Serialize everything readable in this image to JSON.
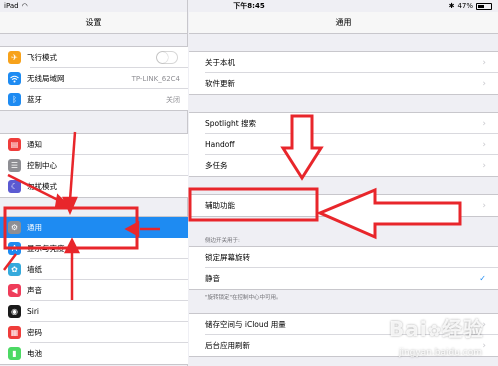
{
  "status_bar": {
    "device": "iPad",
    "time": "下午8:45",
    "battery": "47%",
    "battery_fraction": 0.47
  },
  "left_pane": {
    "title": "设置",
    "group1": [
      {
        "label": "飞行模式",
        "icon": "airplane-icon",
        "color": "#f7a21b",
        "value": "",
        "toggle": false
      },
      {
        "label": "无线局域网",
        "icon": "wifi-icon",
        "color": "#1e8bf2",
        "value": "TP-LINK_62C4"
      },
      {
        "label": "蓝牙",
        "icon": "bluetooth-icon",
        "color": "#1e8bf2",
        "value": "关闭"
      }
    ],
    "group2": [
      {
        "label": "通知",
        "icon": "notifications-icon",
        "color": "#ef3d3b"
      },
      {
        "label": "控制中心",
        "icon": "control-center-icon",
        "color": "#8e8e93"
      },
      {
        "label": "勿扰模式",
        "icon": "moon-icon",
        "color": "#5b5ad2"
      }
    ],
    "group3": [
      {
        "label": "通用",
        "icon": "gear-icon",
        "color": "#8e8e93",
        "selected": true
      },
      {
        "label": "显示与亮度",
        "icon": "brightness-icon",
        "color": "#1e8bf2"
      },
      {
        "label": "墙纸",
        "icon": "wallpaper-icon",
        "color": "#35aadc"
      },
      {
        "label": "声音",
        "icon": "sound-icon",
        "color": "#ef3d5a"
      },
      {
        "label": "Siri",
        "icon": "siri-icon",
        "color": "#1a1a1a"
      },
      {
        "label": "密码",
        "icon": "passcode-icon",
        "color": "#ef3d3b"
      },
      {
        "label": "电池",
        "icon": "battery-icon",
        "color": "#4cd964"
      }
    ]
  },
  "right_pane": {
    "title": "通用",
    "group1": [
      {
        "label": "关于本机"
      },
      {
        "label": "软件更新"
      }
    ],
    "group2": [
      {
        "label": "Spotlight 搜索"
      },
      {
        "label": "Handoff"
      },
      {
        "label": "多任务"
      }
    ],
    "group3": [
      {
        "label": "辅助功能"
      }
    ],
    "section4_header": "侧边开关用于:",
    "group4": [
      {
        "label": "锁定屏幕旋转",
        "checked": false
      },
      {
        "label": "静音",
        "checked": true
      }
    ],
    "section4_footer": "\"旋转锁定\"在控制中心中可用。",
    "group5": [
      {
        "label": "储存空间与 iCloud 用量"
      },
      {
        "label": "后台应用刷新"
      }
    ]
  },
  "watermark": {
    "brand": "Bai",
    "brand2": "经验",
    "url": "jingyan.baidu.com"
  },
  "annotation_color": "#e8262b"
}
